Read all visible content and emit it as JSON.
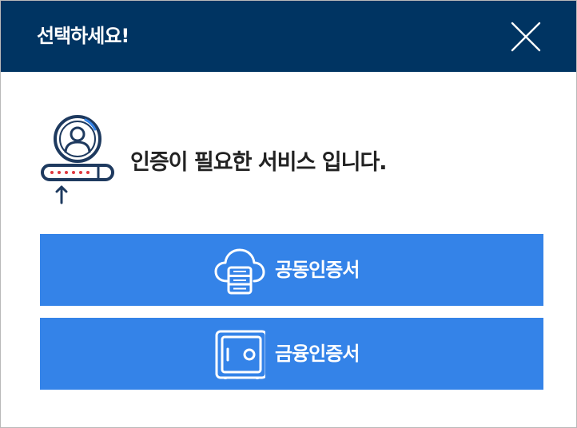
{
  "dialog": {
    "title": "선택하세요!",
    "close_icon": "close-icon"
  },
  "notice": {
    "icon": "user-password-auth-icon",
    "message": "인증이 필요한 서비스 입니다."
  },
  "options": [
    {
      "label": "공동인증서",
      "icon": "cloud-database-icon"
    },
    {
      "label": "금융인증서",
      "icon": "safe-icon"
    }
  ],
  "colors": {
    "header_bg": "#003462",
    "button_bg": "#3483e8",
    "text_dark": "#222222",
    "icon_navy": "#1e3a5f"
  }
}
